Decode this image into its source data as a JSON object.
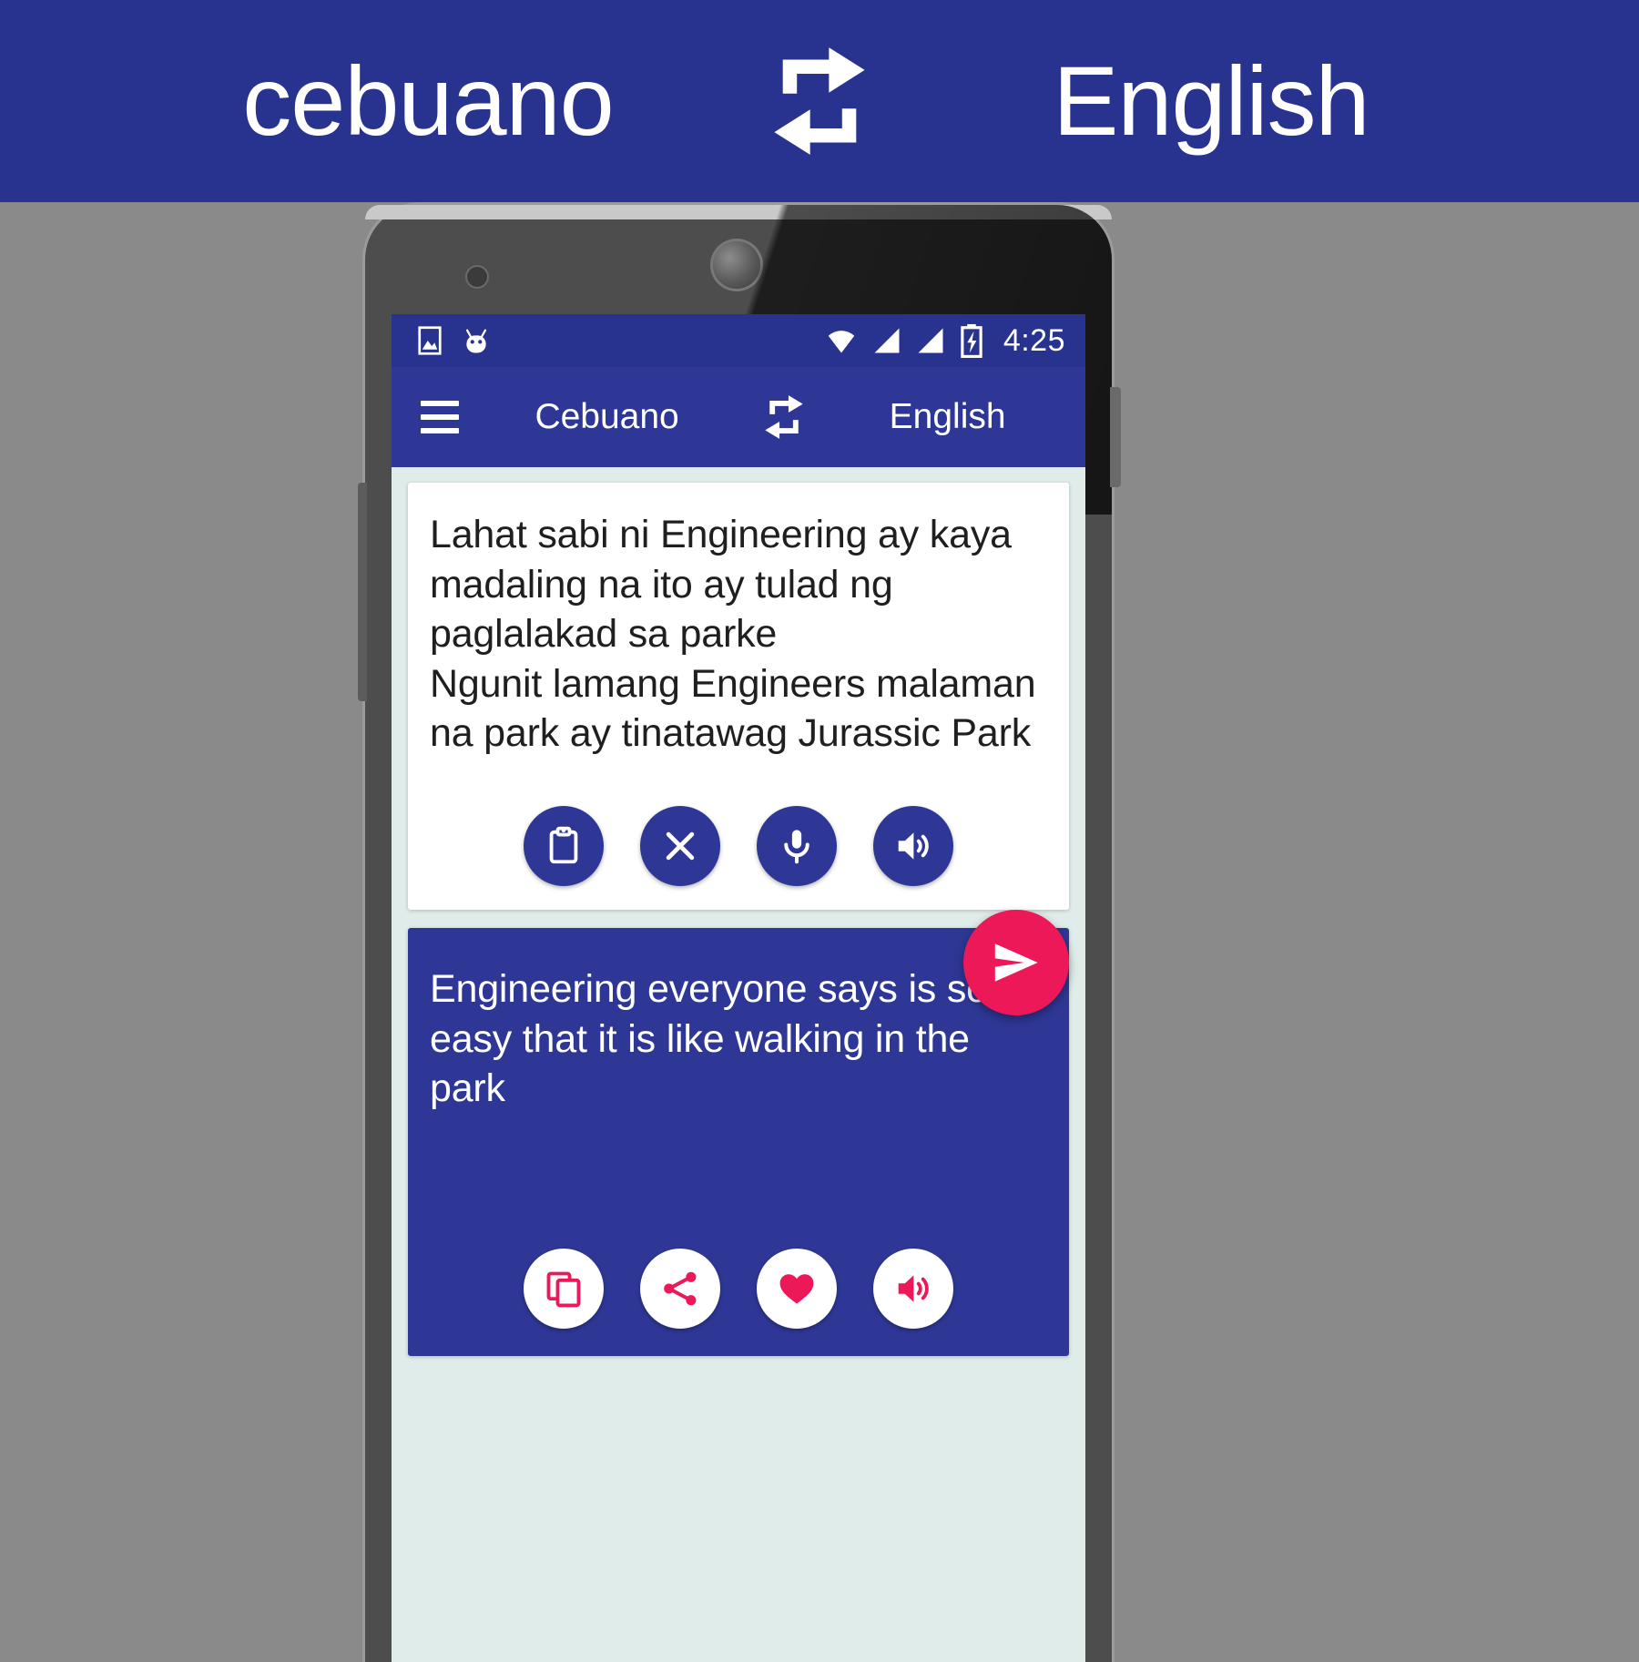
{
  "banner": {
    "source_language": "cebuano",
    "target_language": "English",
    "swap_icon": "swap-arrows-icon",
    "background_color": "#28328f",
    "text_color": "#ffffff"
  },
  "phone": {
    "status_bar": {
      "background_color": "#28328f",
      "icons_left": [
        "image-icon",
        "android-robot-icon"
      ],
      "icons_right": [
        "wifi-icon",
        "signal-icon",
        "signal-icon",
        "battery-charging-icon"
      ],
      "time": "4:25"
    },
    "app_bar": {
      "menu_icon": "hamburger-menu-icon",
      "source_language": "Cebuano",
      "swap_icon": "swap-arrows-icon",
      "target_language": "English",
      "background_color": "#2e3795"
    },
    "source_card": {
      "text": "Lahat sabi ni Engineering ay kaya madaling na ito ay tulad ng paglalakad sa parke\nNgunit lamang Engineers malaman na park ay tinatawag Jurassic Park",
      "background_color": "#ffffff",
      "text_color": "#1f1f1f",
      "actions": [
        {
          "name": "paste-button",
          "icon": "clipboard-icon",
          "label": "Paste"
        },
        {
          "name": "clear-button",
          "icon": "close-icon",
          "label": "Clear"
        },
        {
          "name": "voice-input-button",
          "icon": "microphone-icon",
          "label": "Speak"
        },
        {
          "name": "speak-source-button",
          "icon": "speaker-icon",
          "label": "Listen"
        }
      ],
      "action_color": "#2e3795"
    },
    "send_button": {
      "icon": "send-icon",
      "label": "Translate",
      "color": "#ec1857"
    },
    "target_card": {
      "text": "Engineering everyone says is so easy that it is like walking in the park",
      "background_color": "#2e3795",
      "text_color": "#ffffff",
      "actions": [
        {
          "name": "copy-button",
          "icon": "copy-icon",
          "label": "Copy"
        },
        {
          "name": "share-button",
          "icon": "share-icon",
          "label": "Share"
        },
        {
          "name": "favorite-button",
          "icon": "heart-icon",
          "label": "Favorite"
        },
        {
          "name": "speak-target-button",
          "icon": "speaker-icon",
          "label": "Listen"
        }
      ],
      "action_color": "#ec1857"
    }
  }
}
